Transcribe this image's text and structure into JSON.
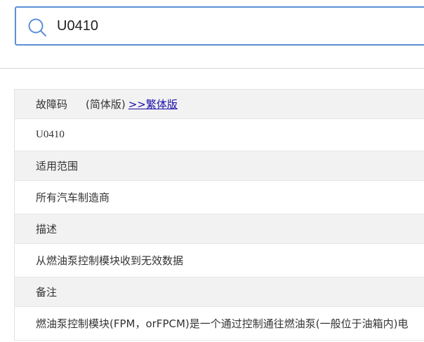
{
  "search": {
    "value": "U0410"
  },
  "table": {
    "code_label": "故障码",
    "simplified_label": "(简体版)",
    "traditional_link": ">>繁体版",
    "code_value": "U0410",
    "scope_label": "适用范围",
    "scope_value": "所有汽车制造商",
    "desc_label": "描述",
    "desc_value": "从燃油泵控制模块收到无效数据",
    "notes_label": "备注",
    "notes_value": "燃油泵控制模块(FPM，orFPCM)是一个通过控制通往燃油泵(一般位于油箱内)电"
  },
  "colors": {
    "accent": "#5a8fd6",
    "header_bg": "#f2f2f2",
    "link": "#1a0dab"
  }
}
